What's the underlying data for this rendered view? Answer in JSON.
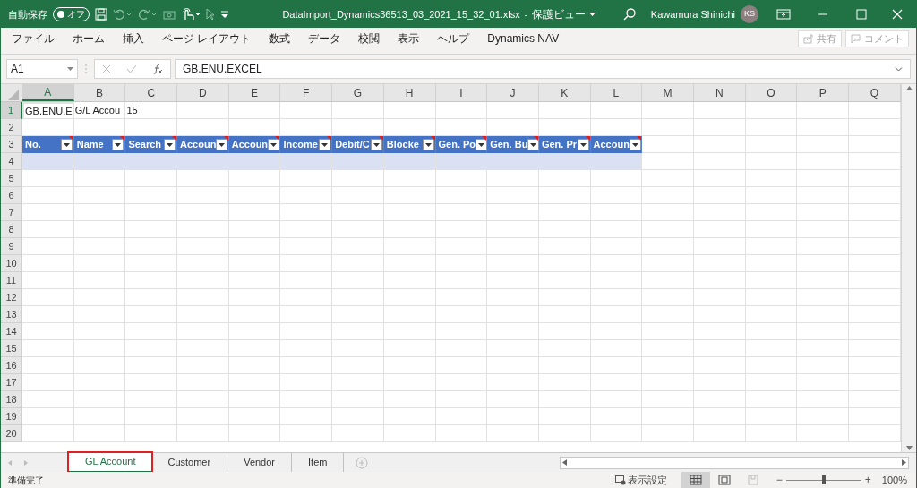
{
  "title_bar": {
    "autosave_label": "自動保存",
    "autosave_toggle": {
      "text": "オフ",
      "on": false
    },
    "filename": "DataImport_Dynamics36513_03_2021_15_32_01.xlsx",
    "separator": "-",
    "mode": "保護ビュー",
    "user_name": "Kawamura Shinichi",
    "user_initials": "KS"
  },
  "ribbon_tabs": [
    "ファイル",
    "ホーム",
    "挿入",
    "ページ レイアウト",
    "数式",
    "データ",
    "校閲",
    "表示",
    "ヘルプ",
    "Dynamics NAV"
  ],
  "ribbon_buttons": [
    {
      "kind": "share",
      "label": "共有"
    },
    {
      "kind": "comment",
      "label": "コメント"
    }
  ],
  "formula_bar": {
    "name_box": "A1",
    "formula": "GB.ENU.EXCEL"
  },
  "grid": {
    "columns": [
      "A",
      "B",
      "C",
      "D",
      "E",
      "F",
      "G",
      "H",
      "I",
      "J",
      "K",
      "L",
      "M",
      "N",
      "O",
      "P",
      "Q"
    ],
    "rows": [
      {
        "number": "1",
        "kind": "plain",
        "cells": [
          {
            "text": "GB.ENU.E",
            "selected": true
          },
          {
            "text": "G/L Accou",
            "selected": false
          },
          {
            "text": "15",
            "selected": false
          }
        ]
      },
      {
        "number": "2",
        "kind": "plain"
      },
      {
        "number": "3",
        "kind": "table_header",
        "cells": [
          {
            "text": "No."
          },
          {
            "text": "Name"
          },
          {
            "text": "Search"
          },
          {
            "text": "Accoun"
          },
          {
            "text": "Accoun"
          },
          {
            "text": "Income"
          },
          {
            "text": "Debit/C"
          },
          {
            "text": "Blocke"
          },
          {
            "text": "Gen. Po"
          },
          {
            "text": "Gen. Bu"
          },
          {
            "text": "Gen. Pr"
          },
          {
            "text": "Accoun"
          }
        ]
      },
      {
        "number": "4",
        "kind": "table_row"
      },
      {
        "number": "5",
        "kind": "plain"
      },
      {
        "number": "6",
        "kind": "plain"
      },
      {
        "number": "7",
        "kind": "plain"
      },
      {
        "number": "8",
        "kind": "plain"
      },
      {
        "number": "9",
        "kind": "plain"
      },
      {
        "number": "10",
        "kind": "plain"
      },
      {
        "number": "11",
        "kind": "plain"
      },
      {
        "number": "12",
        "kind": "plain"
      },
      {
        "number": "13",
        "kind": "plain"
      },
      {
        "number": "14",
        "kind": "plain"
      },
      {
        "number": "15",
        "kind": "plain"
      },
      {
        "number": "16",
        "kind": "plain"
      },
      {
        "number": "17",
        "kind": "plain"
      },
      {
        "number": "18",
        "kind": "plain"
      },
      {
        "number": "19",
        "kind": "plain"
      },
      {
        "number": "20",
        "kind": "plain"
      }
    ]
  },
  "sheet_tabs": [
    {
      "label": "GL Account",
      "selected": true
    },
    {
      "label": "Customer",
      "selected": false
    },
    {
      "label": "Vendor",
      "selected": false
    },
    {
      "label": "Item",
      "selected": false
    }
  ],
  "status_bar": {
    "text": "準備完了",
    "display_settings": "表示設定",
    "views": [
      {
        "kind": "normal",
        "selected": true
      },
      {
        "kind": "page_layout",
        "selected": false
      },
      {
        "kind": "page_break",
        "selected": false
      }
    ],
    "zoom_out": "−",
    "zoom_in": "+",
    "zoom": {
      "level": 0.5,
      "text": "100%"
    }
  }
}
